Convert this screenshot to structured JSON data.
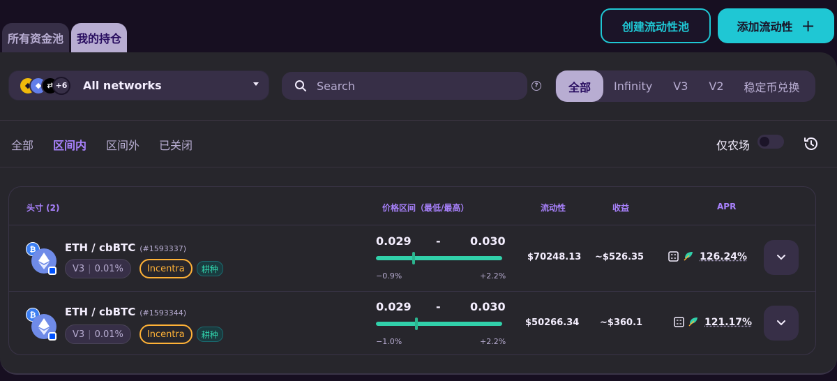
{
  "top_tabs": [
    {
      "label": "所有资金池",
      "active": false
    },
    {
      "label": "我的持仓",
      "active": true
    }
  ],
  "actions": {
    "create_pool": "创建流动性池",
    "add_liquidity": "添加流动性",
    "add_icon": "+"
  },
  "filters": {
    "network_label": "All networks",
    "network_extra": "+6",
    "search_placeholder": "Search",
    "version_tabs": [
      "全部",
      "Infinity",
      "V3",
      "V2",
      "稳定币兑换"
    ],
    "active_version": "全部"
  },
  "status_tabs": [
    "全部",
    "区间内",
    "区间外",
    "已关闭"
  ],
  "active_status": "区间内",
  "farm_only_label": "仅农场",
  "farm_only_enabled": false,
  "table": {
    "headers": {
      "position": "头寸 (2)",
      "price_range": "价格区间（最低/最高）",
      "liquidity": "流动性",
      "earnings": "收益",
      "apr": "APR"
    },
    "rows": [
      {
        "pair": "ETH / cbBTC",
        "id": "(#1593337)",
        "version": "V3",
        "fee": "0.01%",
        "incentive": "Incentra",
        "farm_tag": "耕种",
        "min": "0.029",
        "dash": "-",
        "max": "0.030",
        "lo_pct": "−0.9%",
        "hi_pct": "+2.2%",
        "current_position": 0.29,
        "liquidity": "$70248.13",
        "earnings": "~$526.35",
        "apr": "126.24%"
      },
      {
        "pair": "ETH / cbBTC",
        "id": "(#1593344)",
        "version": "V3",
        "fee": "0.01%",
        "incentive": "Incentra",
        "farm_tag": "耕种",
        "min": "0.029",
        "dash": "-",
        "max": "0.030",
        "lo_pct": "−1.0%",
        "hi_pct": "+2.2%",
        "current_position": 0.31,
        "liquidity": "$50266.34",
        "earnings": "~$360.1",
        "apr": "121.17%"
      }
    ]
  },
  "colors": {
    "accent": "#1fc7d4",
    "purple": "#a881fc",
    "range": "#31d0aa",
    "incentive": "#ffb237"
  }
}
